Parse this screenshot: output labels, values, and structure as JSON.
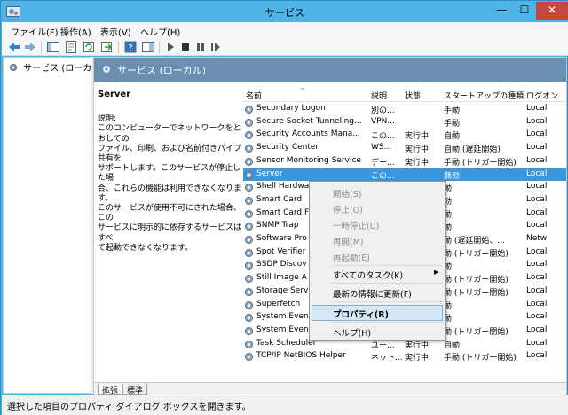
{
  "window": {
    "title": "サービス",
    "min": "—",
    "max": "☐",
    "close": "✕"
  },
  "menu": [
    "ファイル(F)",
    "操作(A)",
    "表示(V)",
    "ヘルプ(H)"
  ],
  "tree": {
    "root": "サービス (ローカル)"
  },
  "pane_header": "サービス (ローカル)",
  "description": {
    "service_name": "Server",
    "label": "説明:",
    "lines": [
      "このコンピューターでネットワークをとおしての",
      "ファイル、印刷、および名前付きパイプ共有を",
      "サポートします。このサービスが停止した場",
      "合、これらの機能は利用できなくなります。",
      "このサービスが使用不可にされた場合、この",
      "サービスに明示的に依存するサービスはすべ",
      "て起動できなくなります。"
    ]
  },
  "columns": [
    "名前",
    "説明",
    "状態",
    "スタートアップの種類",
    "ログオン"
  ],
  "sort_arrow": "^",
  "rows": [
    [
      "Secondary Logon",
      "別の...",
      "",
      "手動",
      "Local"
    ],
    [
      "Secure Socket Tunneling...",
      "VPN...",
      "",
      "手動",
      "Local"
    ],
    [
      "Security Accounts Mana...",
      "この...",
      "実行中",
      "自動",
      "Local"
    ],
    [
      "Security Center",
      "WS...",
      "実行中",
      "自動 (遅延開始)",
      "Local"
    ],
    [
      "Sensor Monitoring Service",
      "デー...",
      "実行中",
      "手動 (トリガー開始)",
      "Local"
    ],
    [
      "Server",
      "この...",
      "",
      "無効",
      "Local"
    ],
    [
      "Shell Hardwa",
      "",
      "",
      "動",
      "Local"
    ],
    [
      "Smart Card",
      "",
      "",
      "効",
      "Local"
    ],
    [
      "Smart Card F",
      "",
      "",
      "動",
      "Local"
    ],
    [
      "SNMP Trap",
      "",
      "",
      "動",
      "Local"
    ],
    [
      "Software Pro",
      "",
      "",
      "動 (遅延開始、...",
      "Netw"
    ],
    [
      "Spot Verifier",
      "",
      "",
      "動 (トリガー開始)",
      "Local"
    ],
    [
      "SSDP Discov",
      "",
      "",
      "動",
      "Local"
    ],
    [
      "Still Image A",
      "",
      "",
      "動 (トリガー開始)",
      "Local"
    ],
    [
      "Storage Serv",
      "",
      "",
      "動 (トリガー開始)",
      "Local"
    ],
    [
      "Superfetch",
      "",
      "",
      "動",
      "Local"
    ],
    [
      "System Even",
      "",
      "",
      "動",
      "Local"
    ],
    [
      "System Even",
      "",
      "",
      "動 (トリガー開始)",
      "Local"
    ],
    [
      "Task Scheduler",
      "ユー...",
      "実行中",
      "自動",
      "Local"
    ],
    [
      "TCP/IP NetBIOS Helper",
      "ネット...",
      "実行中",
      "手動 (トリガー開始)",
      "Local"
    ]
  ],
  "selected_row": 5,
  "context_menu": {
    "start": "開始(S)",
    "stop": "停止(O)",
    "pause": "一時停止(U)",
    "resume": "再開(M)",
    "restart": "再起動(E)",
    "all_tasks": "すべてのタスク(K)",
    "refresh": "最新の情報に更新(F)",
    "properties": "プロパティ(R)",
    "help": "ヘルプ(H)",
    "submenu_arrow": "▶"
  },
  "tabs": [
    "拡張",
    "標準"
  ],
  "status": "選択した項目のプロパティ ダイアログ ボックスを開きます。",
  "colors": {
    "titlebar": "#4fb3e6",
    "header": "#6b8fb3",
    "selection": "#3a96dd",
    "close": "#c7463f"
  }
}
